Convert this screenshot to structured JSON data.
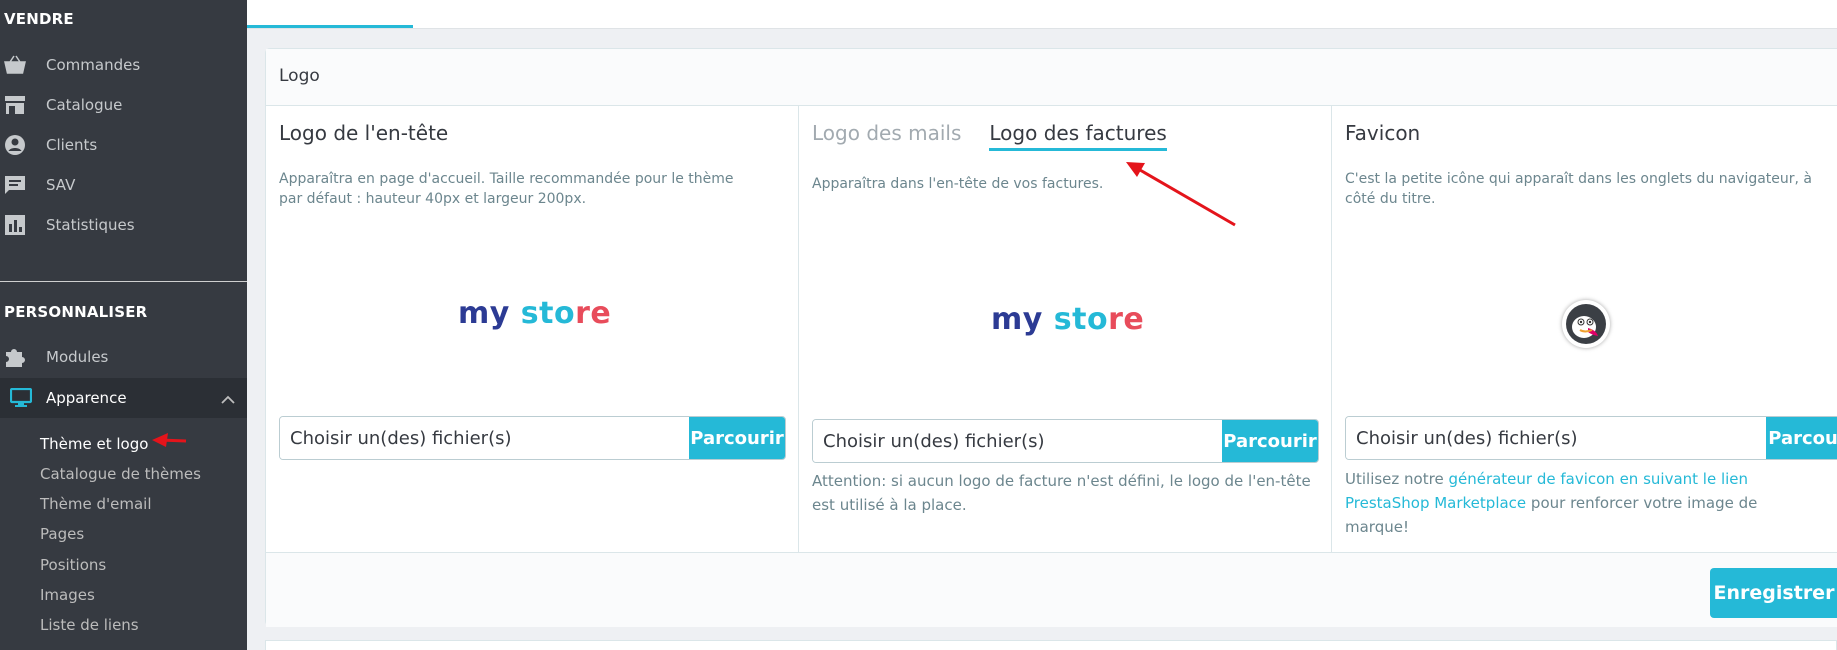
{
  "sidebar": {
    "section_sell": "VENDRE",
    "items": [
      {
        "label": "Commandes",
        "icon": "basket-icon"
      },
      {
        "label": "Catalogue",
        "icon": "store-icon"
      },
      {
        "label": "Clients",
        "icon": "user-circle-icon"
      },
      {
        "label": "SAV",
        "icon": "chat-icon"
      },
      {
        "label": "Statistiques",
        "icon": "stats-icon"
      }
    ],
    "section_customize": "PERSONNALISER",
    "modules_label": "Modules",
    "appearance_label": "Apparence",
    "sub_items": [
      {
        "label": "Thème et logo",
        "active": true
      },
      {
        "label": "Catalogue de thèmes"
      },
      {
        "label": "Thème d'email"
      },
      {
        "label": "Pages"
      },
      {
        "label": "Positions"
      },
      {
        "label": "Images"
      },
      {
        "label": "Liste de liens"
      }
    ]
  },
  "card": {
    "title": "Logo",
    "header_logo": {
      "title": "Logo de l'en-tête",
      "description": "Apparaîtra en page d'accueil. Taille recommandée pour le thème par défaut : hauteur 40px et largeur 200px.",
      "file_placeholder": "Choisir un(des) fichier(s)",
      "browse_label": "Parcourir"
    },
    "mail_invoice": {
      "tab_mail": "Logo des mails",
      "tab_invoice": "Logo des factures",
      "description": "Apparaîtra dans l'en-tête de vos factures.",
      "file_placeholder": "Choisir un(des) fichier(s)",
      "browse_label": "Parcourir",
      "help": "Attention: si aucun logo de facture n'est défini, le logo de l'en-tête est utilisé à la place."
    },
    "favicon": {
      "title": "Favicon",
      "description": "C'est la petite icône qui apparaît dans les onglets du navigateur, à côté du titre.",
      "file_placeholder": "Choisir un(des) fichier(s)",
      "browse_label": "Parcourir",
      "help_before": "Utilisez notre ",
      "help_link": "générateur de favicon en suivant le lien PrestaShop Marketplace",
      "help_after": " pour renforcer votre image de marque!"
    },
    "save_label": "Enregistrer"
  },
  "logo_text": {
    "my": "my",
    "store_a": "sto",
    "store_b": "re"
  },
  "colors": {
    "accent": "#25b9d7",
    "sidebar": "#363a41",
    "annotation_arrow": "#e4141b"
  }
}
